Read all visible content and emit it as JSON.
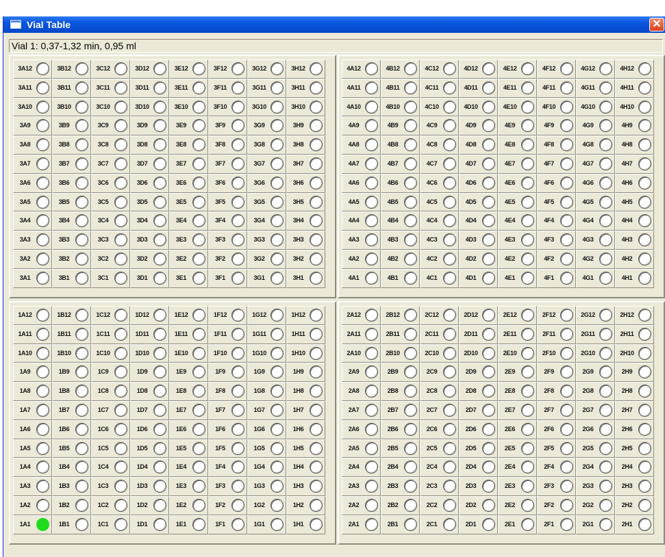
{
  "window": {
    "title": "Vial Table",
    "close_glyph": "✕"
  },
  "status": "Vial 1: 0,37-1,32 min, 0,95 ml",
  "accent_color": "#1fdc1f",
  "active_vial": "1A1",
  "trays": [
    {
      "id": "3",
      "columns": [
        "3A",
        "3B",
        "3C",
        "3D",
        "3E",
        "3F",
        "3G",
        "3H"
      ],
      "rows": [
        "12",
        "11",
        "10",
        "9",
        "8",
        "7",
        "6",
        "5",
        "4",
        "3",
        "2",
        "1"
      ]
    },
    {
      "id": "4",
      "columns": [
        "4A",
        "4B",
        "4C",
        "4D",
        "4E",
        "4F",
        "4G",
        "4H"
      ],
      "rows": [
        "12",
        "11",
        "10",
        "9",
        "8",
        "7",
        "6",
        "5",
        "4",
        "3",
        "2",
        "1"
      ]
    },
    {
      "id": "1",
      "columns": [
        "1A",
        "1B",
        "1C",
        "1D",
        "1E",
        "1F",
        "1G",
        "1H"
      ],
      "rows": [
        "12",
        "11",
        "10",
        "9",
        "8",
        "7",
        "6",
        "5",
        "4",
        "3",
        "2",
        "1"
      ]
    },
    {
      "id": "2",
      "columns": [
        "2A",
        "2B",
        "2C",
        "2D",
        "2E",
        "2F",
        "2G",
        "2H"
      ],
      "rows": [
        "12",
        "11",
        "10",
        "9",
        "8",
        "7",
        "6",
        "5",
        "4",
        "3",
        "2",
        "1"
      ]
    }
  ]
}
